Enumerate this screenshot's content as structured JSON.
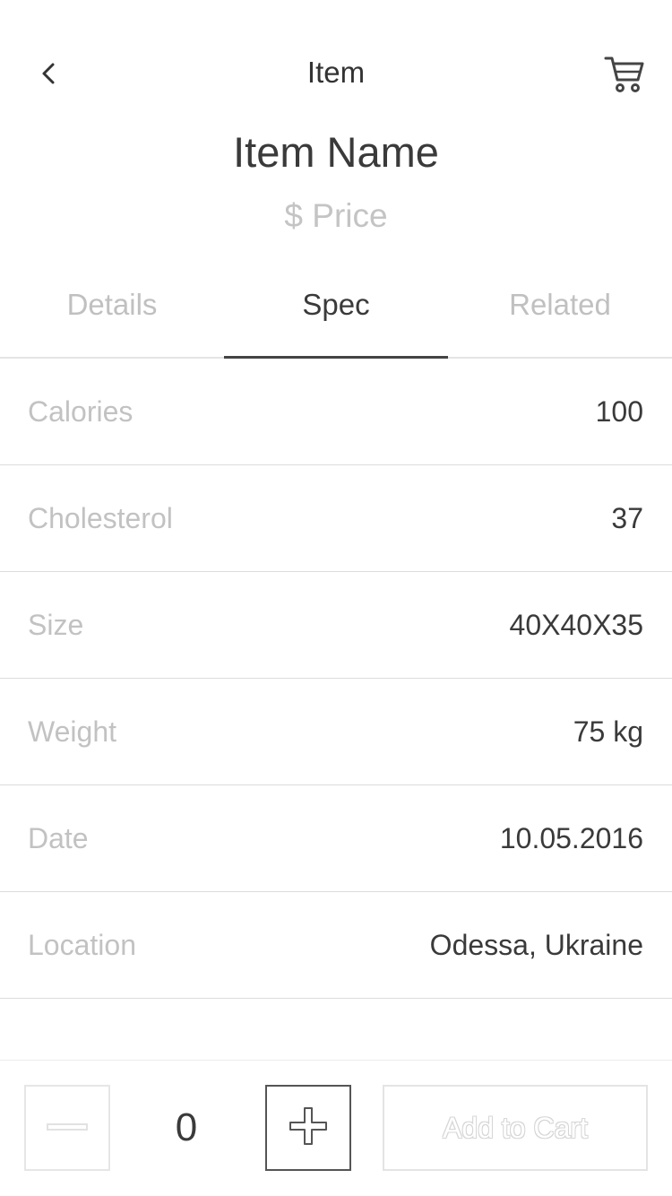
{
  "nav": {
    "back_icon": "chevron-left-icon",
    "title": "Item",
    "cart_icon": "cart-icon"
  },
  "header": {
    "item_name": "Item Name",
    "price": "$ Price"
  },
  "tabs": [
    {
      "label": "Details",
      "active": false
    },
    {
      "label": "Spec",
      "active": true
    },
    {
      "label": "Related",
      "active": false
    }
  ],
  "specs": [
    {
      "label": "Calories",
      "value": "100"
    },
    {
      "label": "Cholesterol",
      "value": "37"
    },
    {
      "label": "Size",
      "value": "40X40X35"
    },
    {
      "label": "Weight",
      "value": "75 kg"
    },
    {
      "label": "Date",
      "value": "10.05.2016"
    },
    {
      "label": "Location",
      "value": "Odessa, Ukraine"
    }
  ],
  "bottom": {
    "minus_icon": "minus-icon",
    "quantity": "0",
    "plus_icon": "plus-icon",
    "add_to_cart_label": "Add to Cart"
  },
  "colors": {
    "text_primary": "#3a3a3a",
    "text_muted": "#c2c2c2",
    "divider": "#dcdcdc",
    "tab_indicator": "#444444"
  }
}
